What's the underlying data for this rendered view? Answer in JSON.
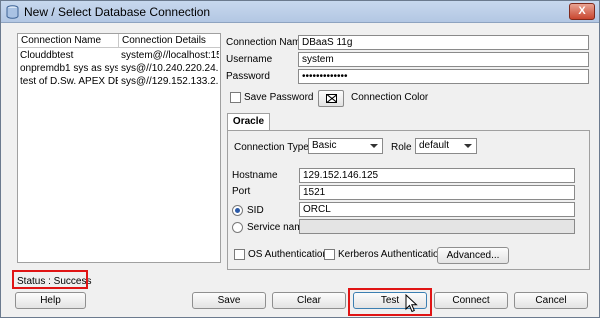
{
  "window": {
    "title": "New / Select Database Connection",
    "close_label": "X"
  },
  "connections": {
    "headers": {
      "name": "Connection Name",
      "details": "Connection Details"
    },
    "rows": [
      {
        "name": "Clouddbtest",
        "details": "system@//localhost:15..."
      },
      {
        "name": "onpremdb1 sys as sys...",
        "details": "sys@//10.240.220.24..."
      },
      {
        "name": "test of D.Sw. APEX DB...",
        "details": "sys@//129.152.133.2..."
      }
    ]
  },
  "form": {
    "connection_name": {
      "label": "Connection Name",
      "value": "DBaaS 11g"
    },
    "username": {
      "label": "Username",
      "value": "system"
    },
    "password": {
      "label": "Password",
      "value": "•••••••••••••"
    },
    "save_password": {
      "label": "Save Password",
      "checked": false
    },
    "connection_color": {
      "label": "Connection Color"
    }
  },
  "oracle_tab": {
    "tab_label": "Oracle",
    "connection_type": {
      "label": "Connection Type",
      "value": "Basic"
    },
    "role": {
      "label": "Role",
      "value": "default"
    },
    "hostname": {
      "label": "Hostname",
      "value": "129.152.146.125"
    },
    "port": {
      "label": "Port",
      "value": "1521"
    },
    "sid": {
      "label": "SID",
      "value": "ORCL",
      "selected": true
    },
    "service_name": {
      "label": "Service name",
      "value": ""
    },
    "os_auth": {
      "label": "OS Authentication",
      "checked": false
    },
    "kerberos_auth": {
      "label": "Kerberos Authentication",
      "checked": false
    },
    "advanced_label": "Advanced..."
  },
  "status": {
    "text": "Status : Success"
  },
  "buttons": {
    "help": "Help",
    "save": "Save",
    "clear": "Clear",
    "test": "Test",
    "connect": "Connect",
    "cancel": "Cancel"
  },
  "colors": {
    "highlight": "#e01414",
    "titlebar": "#b3c7e3"
  }
}
